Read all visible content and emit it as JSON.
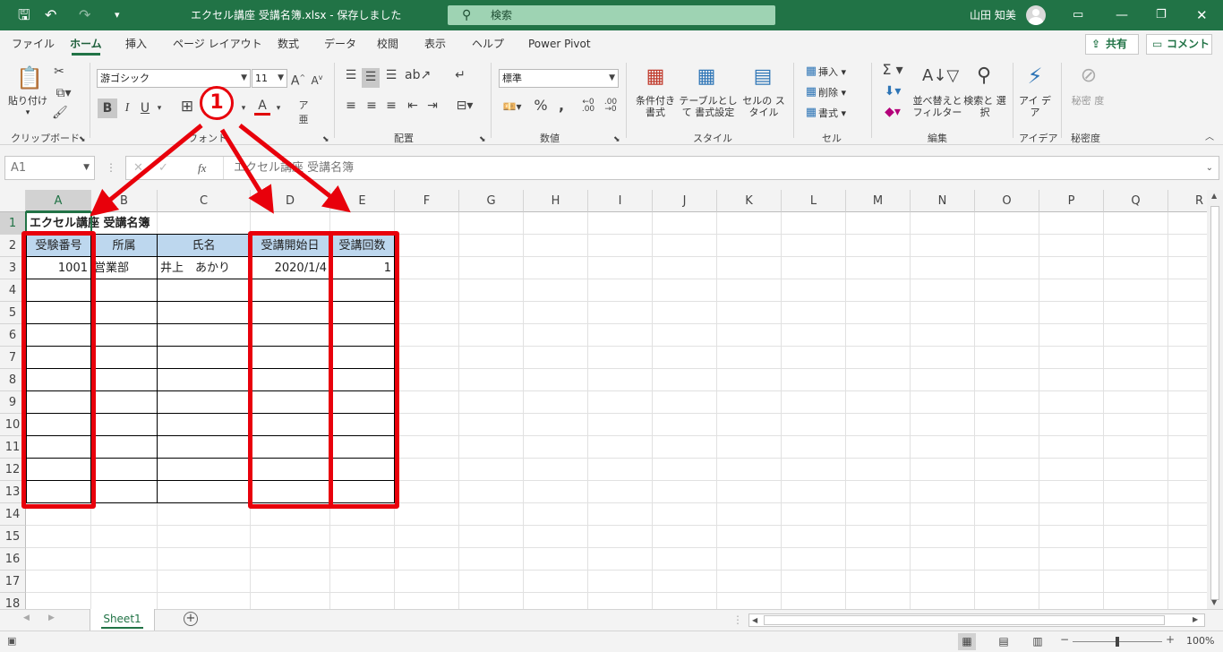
{
  "window": {
    "title": "エクセル講座 受講名簿.xlsx  -  保存しました",
    "search_placeholder": "検索",
    "user_name": "山田 知美"
  },
  "menu": {
    "tabs": [
      "ファイル",
      "ホーム",
      "挿入",
      "ページ レイアウト",
      "数式",
      "データ",
      "校閲",
      "表示",
      "ヘルプ",
      "Power Pivot"
    ],
    "active_tab": "ホーム",
    "share": "共有",
    "comment": "コメント"
  },
  "ribbon": {
    "paste": "貼り付け",
    "font_name": "游ゴシック",
    "font_size": "11",
    "number_format": "標準",
    "conditional_format": "条件付き 書式",
    "format_as_table": "テーブルとして 書式設定",
    "cell_styles": "セルの スタイル",
    "insert": "挿入",
    "delete": "削除",
    "format": "書式",
    "sort_filter": "並べ替えと フィルター",
    "find_select": "検索と 選択",
    "ideas": "アイ デア",
    "sensitivity": "秘密 度",
    "groups": [
      "クリップボード",
      "フォント",
      "配置",
      "数値",
      "スタイル",
      "セル",
      "編集",
      "アイデア",
      "秘密度"
    ]
  },
  "formula_bar": {
    "name_box": "A1",
    "content": "エクセル講座 受講名簿"
  },
  "sheet": {
    "columns": [
      "A",
      "B",
      "C",
      "D",
      "E",
      "F",
      "G",
      "H",
      "I",
      "J",
      "K",
      "L",
      "M",
      "N",
      "O",
      "P",
      "Q",
      "R"
    ],
    "rows": [
      "1",
      "2",
      "3",
      "4",
      "5",
      "6",
      "7",
      "8",
      "9",
      "10",
      "11",
      "12",
      "13",
      "14",
      "15",
      "16",
      "17",
      "18"
    ],
    "title": "エクセル講座 受講名簿",
    "headers": [
      "受験番号",
      "所属",
      "氏名",
      "受講開始日",
      "受講回数"
    ],
    "row3": [
      "1001",
      "営業部",
      "井上　あかり",
      "2020/1/4",
      "1"
    ]
  },
  "annotation": {
    "step_number": "1"
  },
  "sheet_tabs": {
    "active": "Sheet1"
  },
  "status": {
    "zoom": "100%"
  },
  "colors": {
    "excel_green": "#217346",
    "header_fill": "#bdd7ee",
    "annotation_red": "#e8000b"
  }
}
